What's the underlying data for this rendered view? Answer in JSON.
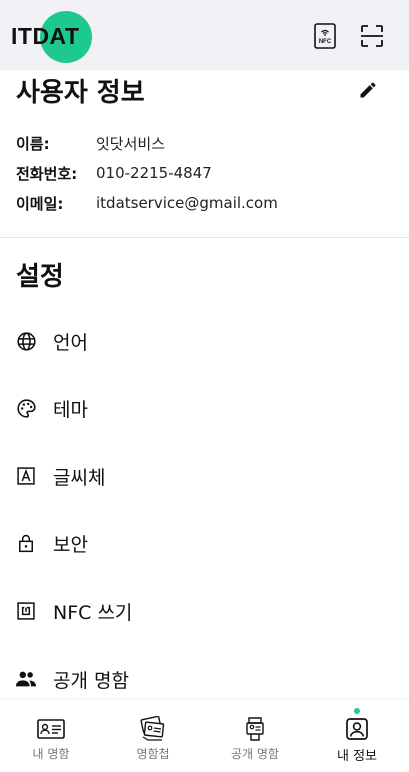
{
  "header": {
    "logo_text": "ITDAT",
    "accent_color": "#1ec98d",
    "nfc_button": {
      "icon": "nfc-phone-icon",
      "icon_text": "NFC"
    },
    "scan_button": {
      "icon": "qr-scan-icon"
    }
  },
  "user_info": {
    "title": "사용자 정보",
    "edit_icon": "pencil-icon",
    "rows": [
      {
        "label": "이름:",
        "value": "잇닷서비스"
      },
      {
        "label": "전화번호:",
        "value": "010-2215-4847"
      },
      {
        "label": "이메일:",
        "value": "itdatservice@gmail.com"
      }
    ]
  },
  "settings": {
    "title": "설정",
    "items": [
      {
        "label": "언어",
        "icon": "globe-icon"
      },
      {
        "label": "테마",
        "icon": "palette-icon"
      },
      {
        "label": "글씨체",
        "icon": "font-icon"
      },
      {
        "label": "보안",
        "icon": "lock-icon"
      },
      {
        "label": "NFC 쓰기",
        "icon": "nfc-icon"
      },
      {
        "label": "공개 명함",
        "icon": "people-icon"
      }
    ]
  },
  "bottom_nav": {
    "items": [
      {
        "label": "내 명함",
        "icon": "card-icon",
        "active": false
      },
      {
        "label": "명함첩",
        "icon": "cardbook-icon",
        "active": false
      },
      {
        "label": "공개 명함",
        "icon": "public-card-icon",
        "active": false
      },
      {
        "label": "내 정보",
        "icon": "profile-icon",
        "active": true
      }
    ]
  }
}
